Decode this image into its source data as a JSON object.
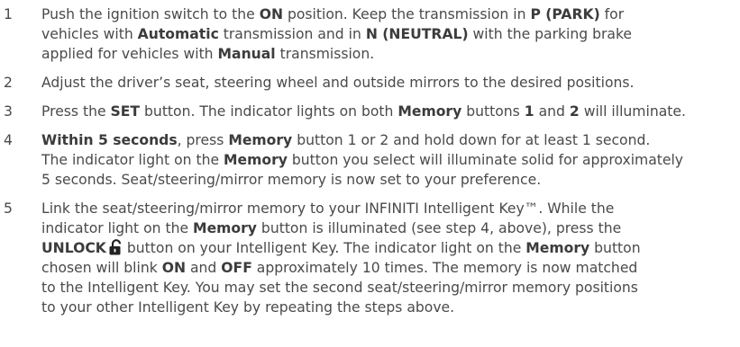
{
  "steps": [
    {
      "number": "1",
      "segments": [
        {
          "text": "Push the ignition switch to the "
        },
        {
          "text": "ON",
          "bold": true
        },
        {
          "text": " position. Keep the transmission in "
        },
        {
          "text": "P (PARK)",
          "bold": true
        },
        {
          "text": " for\nvehicles with "
        },
        {
          "text": "Automatic",
          "bold": true
        },
        {
          "text": " transmission and in "
        },
        {
          "text": "N (NEUTRAL)",
          "bold": true
        },
        {
          "text": " with the parking brake\napplied for vehicles with "
        },
        {
          "text": "Manual",
          "bold": true
        },
        {
          "text": " transmission."
        }
      ]
    },
    {
      "number": "2",
      "segments": [
        {
          "text": "Adjust the driver’s seat, steering wheel and outside mirrors to the desired positions."
        }
      ]
    },
    {
      "number": "3",
      "segments": [
        {
          "text": "Press the "
        },
        {
          "text": "SET",
          "bold": true
        },
        {
          "text": " button. The indicator lights on both "
        },
        {
          "text": "Memory",
          "bold": true
        },
        {
          "text": " buttons "
        },
        {
          "text": "1",
          "bold": true
        },
        {
          "text": " and "
        },
        {
          "text": "2",
          "bold": true
        },
        {
          "text": " will illuminate."
        }
      ]
    },
    {
      "number": "4",
      "segments": [
        {
          "text": "Within 5 seconds",
          "bold": true
        },
        {
          "text": ", press "
        },
        {
          "text": "Memory",
          "bold": true
        },
        {
          "text": " button 1 or 2 and hold down for at least 1 second.\nThe indicator light on the "
        },
        {
          "text": "Memory",
          "bold": true
        },
        {
          "text": " button you select will illuminate solid for approximately\n5 seconds. Seat/steering/mirror memory is now set to your preference."
        }
      ]
    },
    {
      "number": "5",
      "segments": [
        {
          "text": "Link the seat/steering/mirror memory to your INFINITI Intelligent Key™. While the\nindicator light on the "
        },
        {
          "text": "Memory",
          "bold": true
        },
        {
          "text": " button is illuminated (see step 4, above), press the\n"
        },
        {
          "text": "UNLOCK",
          "bold": true
        },
        {
          "icon": "unlock-icon"
        },
        {
          "text": "button on your Intelligent Key. The indicator light on the "
        },
        {
          "text": "Memory",
          "bold": true
        },
        {
          "text": " button\nchosen will blink "
        },
        {
          "text": "ON",
          "bold": true
        },
        {
          "text": " and "
        },
        {
          "text": "OFF",
          "bold": true
        },
        {
          "text": " approximately 10 times. The memory is now matched\nto the Intelligent Key. You may set the second seat/steering/mirror memory positions\nto your other Intelligent Key by repeating the steps above."
        }
      ]
    }
  ]
}
